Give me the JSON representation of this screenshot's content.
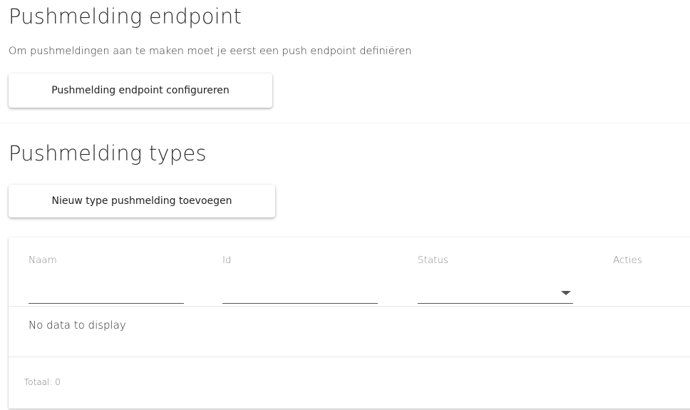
{
  "endpoint": {
    "title": "Pushmelding endpoint",
    "description": "Om pushmeldingen aan te maken moet je eerst een push endpoint definiëren",
    "configure_button": "Pushmelding endpoint configureren"
  },
  "types": {
    "title": "Pushmelding types",
    "add_button": "Nieuw type pushmelding toevoegen"
  },
  "grid": {
    "columns": [
      "Naam",
      "Id",
      "Status",
      "Acties"
    ],
    "filters": {
      "naam": "",
      "id": "",
      "status": ""
    },
    "empty_message": "No data to display",
    "footer": "Totaal: 0"
  },
  "icons": {
    "status_dropdown": "caret-down-icon"
  }
}
